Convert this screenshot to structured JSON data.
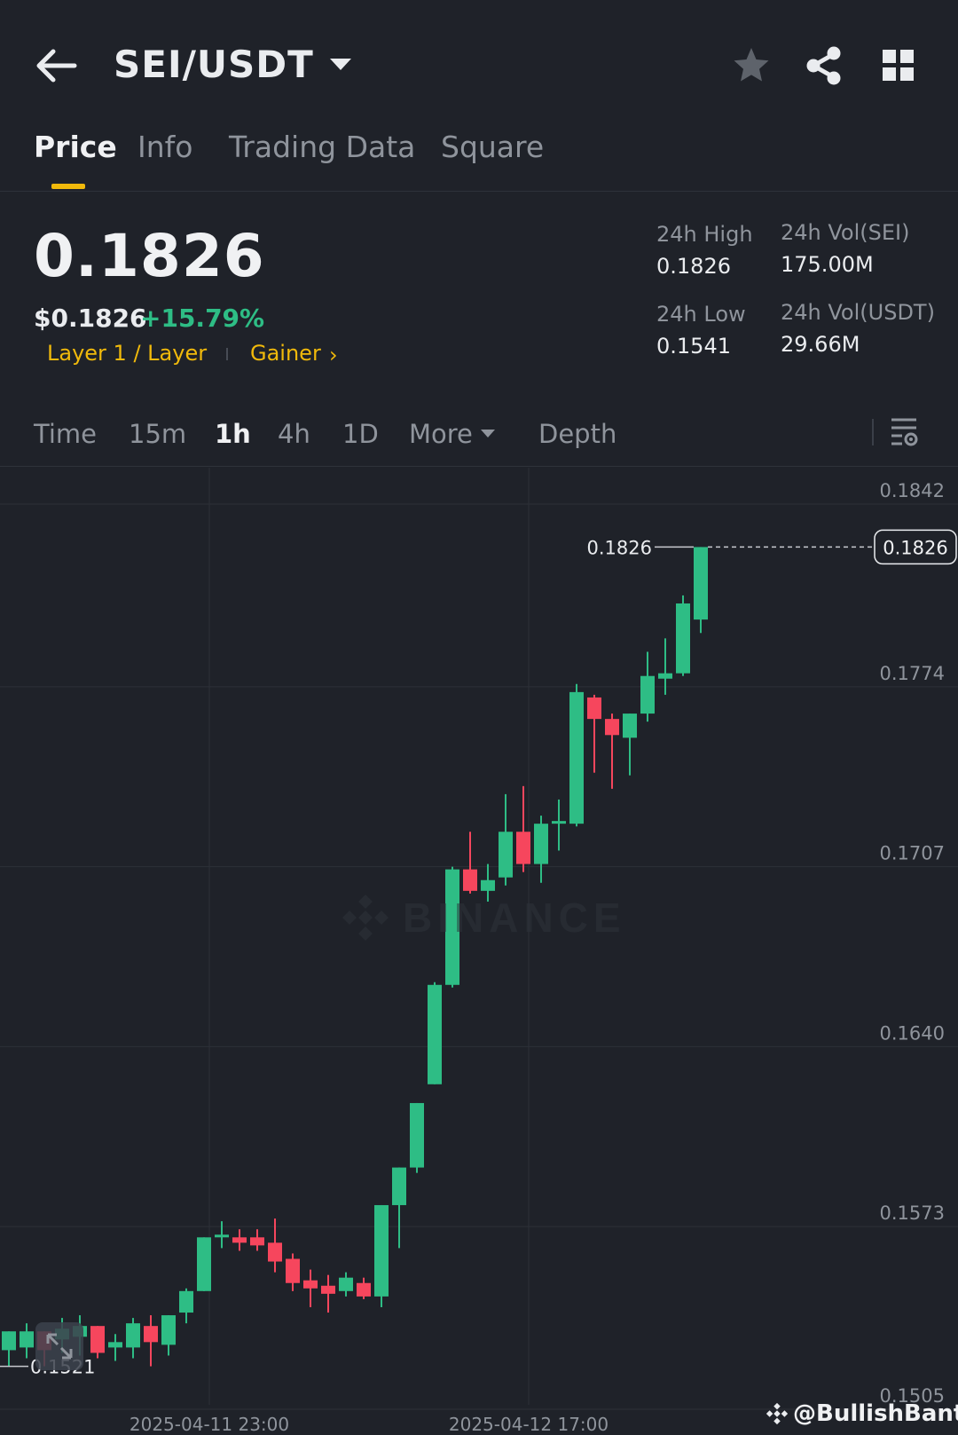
{
  "header": {
    "pair": "SEI/USDT",
    "icons": {
      "back": "arrow-left-icon",
      "favorite": "star-icon",
      "share": "share-icon",
      "menu": "grid-icon"
    }
  },
  "tabs": [
    {
      "label": "Price",
      "active": true
    },
    {
      "label": "Info",
      "active": false
    },
    {
      "label": "Trading Data",
      "active": false
    },
    {
      "label": "Square",
      "active": false
    }
  ],
  "ticker": {
    "last_price": "0.1826",
    "usd_price": "$0.1826",
    "change": "+15.79%",
    "tag_category": "Layer 1 / Layer",
    "tag_gainer": "Gainer",
    "stats": {
      "high_label": "24h High",
      "high_value": "0.1826",
      "low_label": "24h Low",
      "low_value": "0.1541",
      "vol_base_label": "24h Vol(SEI)",
      "vol_base_value": "175.00M",
      "vol_quote_label": "24h Vol(USDT)",
      "vol_quote_value": "29.66M"
    }
  },
  "intervals": {
    "time": "Time",
    "m15": "15m",
    "h1": "1h",
    "h4": "4h",
    "d1": "1D",
    "more": "More",
    "depth": "Depth",
    "active": "1h"
  },
  "colors": {
    "up": "#2ebd85",
    "down": "#f6465d",
    "accent": "#f0b90b",
    "background": "#1f2229",
    "grid": "#2c3038"
  },
  "chart_data": {
    "type": "candlestick",
    "interval": "1h",
    "y_ticks": [
      "0.1842",
      "0.1774",
      "0.1707",
      "0.1640",
      "0.1573",
      "0.1505"
    ],
    "ylim": [
      0.1505,
      0.1842
    ],
    "x_ticks": [
      "2025-04-11 23:00",
      "2025-04-12 17:00"
    ],
    "last_price_label": "0.1826",
    "max_label": "0.1826",
    "min_label": "0.1521",
    "watermark": "BINANCE",
    "candles": [
      {
        "o": 0.1527,
        "h": 0.1534,
        "l": 0.1521,
        "c": 0.1534
      },
      {
        "o": 0.1528,
        "h": 0.1537,
        "l": 0.1524,
        "c": 0.1534
      },
      {
        "o": 0.1534,
        "h": 0.1532,
        "l": 0.1521,
        "c": 0.1527
      },
      {
        "o": 0.1531,
        "h": 0.1539,
        "l": 0.1526,
        "c": 0.1535
      },
      {
        "o": 0.1532,
        "h": 0.154,
        "l": 0.1525,
        "c": 0.1536
      },
      {
        "o": 0.1536,
        "h": 0.1536,
        "l": 0.1524,
        "c": 0.1526
      },
      {
        "o": 0.1528,
        "h": 0.1533,
        "l": 0.1523,
        "c": 0.153
      },
      {
        "o": 0.1528,
        "h": 0.1539,
        "l": 0.1524,
        "c": 0.1537
      },
      {
        "o": 0.1536,
        "h": 0.154,
        "l": 0.1521,
        "c": 0.153
      },
      {
        "o": 0.1529,
        "h": 0.154,
        "l": 0.1525,
        "c": 0.154
      },
      {
        "o": 0.1541,
        "h": 0.155,
        "l": 0.1537,
        "c": 0.1549
      },
      {
        "o": 0.1549,
        "h": 0.1569,
        "l": 0.1549,
        "c": 0.1569
      },
      {
        "o": 0.1569,
        "h": 0.1575,
        "l": 0.1565,
        "c": 0.157
      },
      {
        "o": 0.1569,
        "h": 0.1572,
        "l": 0.1564,
        "c": 0.1567
      },
      {
        "o": 0.1569,
        "h": 0.1572,
        "l": 0.1564,
        "c": 0.1566
      },
      {
        "o": 0.1567,
        "h": 0.1576,
        "l": 0.1556,
        "c": 0.156
      },
      {
        "o": 0.1561,
        "h": 0.1563,
        "l": 0.1549,
        "c": 0.1552
      },
      {
        "o": 0.1553,
        "h": 0.1557,
        "l": 0.1543,
        "c": 0.155
      },
      {
        "o": 0.1551,
        "h": 0.1555,
        "l": 0.1541,
        "c": 0.1548
      },
      {
        "o": 0.1549,
        "h": 0.1556,
        "l": 0.1547,
        "c": 0.1554
      },
      {
        "o": 0.1552,
        "h": 0.1554,
        "l": 0.1546,
        "c": 0.1547
      },
      {
        "o": 0.1547,
        "h": 0.1581,
        "l": 0.1543,
        "c": 0.1581
      },
      {
        "o": 0.1581,
        "h": 0.1595,
        "l": 0.1565,
        "c": 0.1595
      },
      {
        "o": 0.1595,
        "h": 0.1619,
        "l": 0.1593,
        "c": 0.1619
      },
      {
        "o": 0.1626,
        "h": 0.1664,
        "l": 0.1626,
        "c": 0.1663
      },
      {
        "o": 0.1663,
        "h": 0.1707,
        "l": 0.1662,
        "c": 0.1706
      },
      {
        "o": 0.1706,
        "h": 0.172,
        "l": 0.1697,
        "c": 0.1698
      },
      {
        "o": 0.1698,
        "h": 0.1708,
        "l": 0.1694,
        "c": 0.1702
      },
      {
        "o": 0.1703,
        "h": 0.1734,
        "l": 0.17,
        "c": 0.172
      },
      {
        "o": 0.172,
        "h": 0.1737,
        "l": 0.1705,
        "c": 0.1708
      },
      {
        "o": 0.1708,
        "h": 0.1726,
        "l": 0.1701,
        "c": 0.1723
      },
      {
        "o": 0.1723,
        "h": 0.1732,
        "l": 0.1713,
        "c": 0.1724
      },
      {
        "o": 0.1723,
        "h": 0.1775,
        "l": 0.1722,
        "c": 0.1772
      },
      {
        "o": 0.177,
        "h": 0.1771,
        "l": 0.1742,
        "c": 0.1762
      },
      {
        "o": 0.1762,
        "h": 0.1764,
        "l": 0.1736,
        "c": 0.1756
      },
      {
        "o": 0.1755,
        "h": 0.1764,
        "l": 0.1741,
        "c": 0.1764
      },
      {
        "o": 0.1764,
        "h": 0.1787,
        "l": 0.1761,
        "c": 0.1778
      },
      {
        "o": 0.1777,
        "h": 0.1792,
        "l": 0.1771,
        "c": 0.1779
      },
      {
        "o": 0.1779,
        "h": 0.1808,
        "l": 0.1778,
        "c": 0.1805
      },
      {
        "o": 0.1799,
        "h": 0.1826,
        "l": 0.1794,
        "c": 0.1826
      }
    ]
  },
  "credit": "@BullishBanter"
}
